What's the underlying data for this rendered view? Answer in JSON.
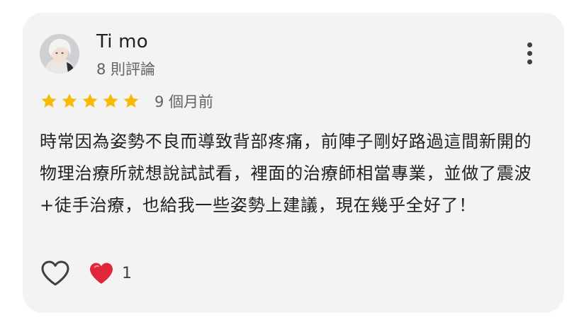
{
  "review": {
    "author_name": "Ti mo",
    "author_review_count": "8 則評論",
    "rating": 5,
    "max_rating": 5,
    "time_ago": "9 個月前",
    "text": "時常因為姿勢不良而導致背部疼痛，前陣子剛好路過這間新開的物理治療所就想說試試看，裡面的治療師相當專業，並做了震波+徒手治療，也給我一些姿勢上建議，現在幾乎全好了！"
  },
  "reactions": {
    "heart_count": "1"
  },
  "icons": {
    "star": "star-icon",
    "more": "more-vert-icon",
    "like": "heart-outline-icon",
    "reaction": "red-heart-icon"
  },
  "colors": {
    "card_background": "#f3f3f4",
    "star": "#f6bb06",
    "reaction_heart": "#e0263a"
  }
}
